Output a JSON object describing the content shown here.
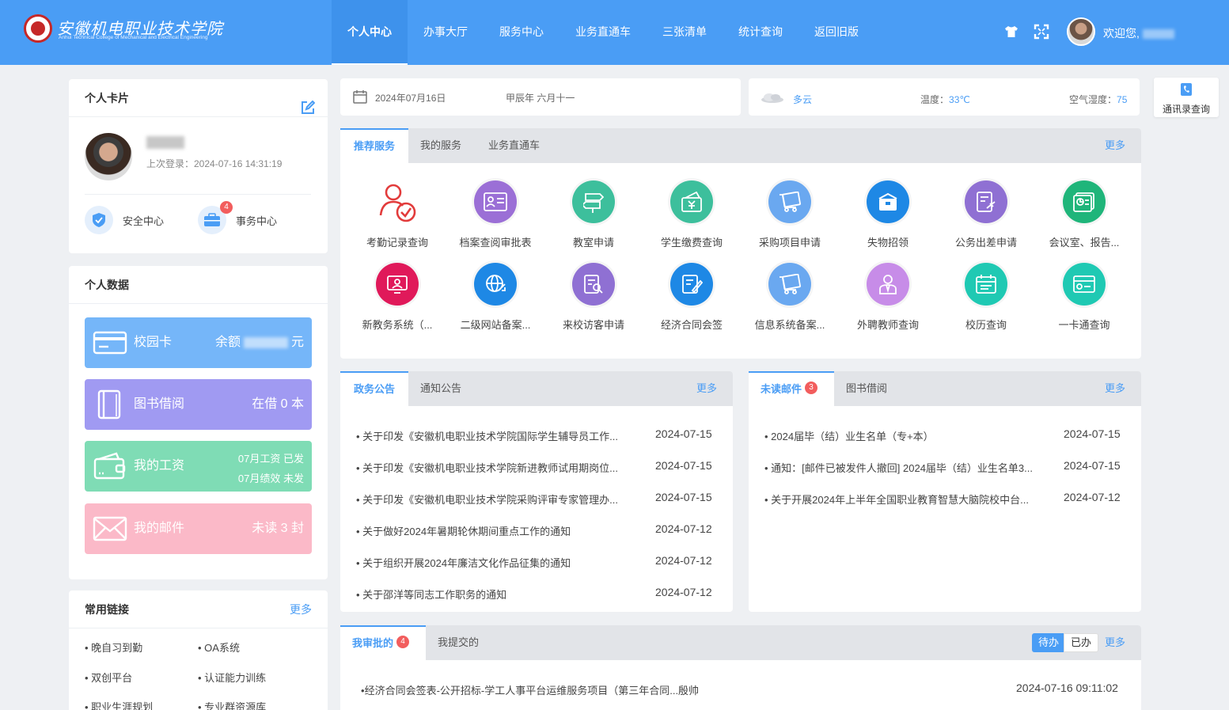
{
  "header": {
    "logo_cn": "安徽机电职业技术学院",
    "logo_en": "Anhui Technical College of Mechanical and Electrical Engineering",
    "nav": [
      "个人中心",
      "办事大厅",
      "服务中心",
      "业务直通车",
      "三张清单",
      "统计查询",
      "返回旧版"
    ],
    "welcome": "欢迎您,"
  },
  "personal_card": {
    "title": "个人卡片",
    "last_login": "上次登录：2024-07-16 14:31:19",
    "security": "安全中心",
    "affairs": "事务中心",
    "affairs_badge": "4"
  },
  "personal_data": {
    "title": "个人数据",
    "campus_card": {
      "name": "校园卡",
      "prefix": "余额",
      "suffix": "元"
    },
    "library": {
      "name": "图书借阅",
      "value": "在借 0 本"
    },
    "salary": {
      "name": "我的工资",
      "line1": "07月工资 已发",
      "line2": "07月绩效 未发"
    },
    "mail": {
      "name": "我的邮件",
      "value": "未读 3 封"
    }
  },
  "links": {
    "title": "常用链接",
    "more": "更多",
    "items": [
      "晚自习到勤",
      "OA系统",
      "双创平台",
      "认证能力训练",
      "职业生涯规划",
      "专业群资源库"
    ]
  },
  "datebar": {
    "date": "2024年07月16日",
    "lunar": "甲辰年 六月十一"
  },
  "weather": {
    "desc": "多云",
    "temp_label": "温度：",
    "temp": "33℃",
    "hum_label": "空气湿度：",
    "hum": "75"
  },
  "contact": "通讯录查询",
  "services": {
    "tabs": [
      "推荐服务",
      "我的服务",
      "业务直通车"
    ],
    "more": "更多",
    "items": [
      {
        "label": "考勤记录查询",
        "color": "#ffffff"
      },
      {
        "label": "档案查阅审批表",
        "color": "#9b6fd6"
      },
      {
        "label": "教室申请",
        "color": "#3dbf9c"
      },
      {
        "label": "学生缴费查询",
        "color": "#3dbf9c"
      },
      {
        "label": "采购项目申请",
        "color": "#6aa8f0"
      },
      {
        "label": "失物招领",
        "color": "#1e88e5"
      },
      {
        "label": "公务出差申请",
        "color": "#8f70d3"
      },
      {
        "label": "会议室、报告...",
        "color": "#1fb57a"
      },
      {
        "label": "新教务系统（...",
        "color": "#e0195a"
      },
      {
        "label": "二级网站备案...",
        "color": "#1e88e5"
      },
      {
        "label": "来校访客申请",
        "color": "#8f70d3"
      },
      {
        "label": "经济合同会签",
        "color": "#1e88e5"
      },
      {
        "label": "信息系统备案...",
        "color": "#6aa8f0"
      },
      {
        "label": "外聘教师查询",
        "color": "#c78ce8"
      },
      {
        "label": "校历查询",
        "color": "#1fc9b3"
      },
      {
        "label": "一卡通查询",
        "color": "#1fc9b3"
      }
    ]
  },
  "notices": {
    "tabs": [
      "政务公告",
      "通知公告"
    ],
    "more": "更多",
    "items": [
      {
        "title": "关于印发《安徽机电职业技术学院国际学生辅导员工作...",
        "date": "2024-07-15"
      },
      {
        "title": "关于印发《安徽机电职业技术学院新进教师试用期岗位...",
        "date": "2024-07-15"
      },
      {
        "title": "关于印发《安徽机电职业技术学院采购评审专家管理办...",
        "date": "2024-07-15"
      },
      {
        "title": "关于做好2024年暑期轮休期间重点工作的通知",
        "date": "2024-07-12"
      },
      {
        "title": "关于组织开展2024年廉洁文化作品征集的通知",
        "date": "2024-07-12"
      },
      {
        "title": "关于邵洋等同志工作职务的通知",
        "date": "2024-07-12"
      }
    ]
  },
  "mails": {
    "tabs": [
      "未读邮件",
      "图书借阅"
    ],
    "badge": "3",
    "more": "更多",
    "items": [
      {
        "title": "2024届毕（结）业生名单（专+本）",
        "date": "2024-07-15"
      },
      {
        "title": "通知：[邮件已被发件人撤回] 2024届毕（结）业生名单3...",
        "date": "2024-07-15"
      },
      {
        "title": "关于开展2024年上半年全国职业教育智慧大脑院校中台...",
        "date": "2024-07-12"
      }
    ]
  },
  "approvals": {
    "tabs": [
      "我审批的",
      "我提交的"
    ],
    "badge": "4",
    "seg_pending": "待办",
    "seg_done": "已办",
    "more": "更多",
    "items": [
      {
        "title": "经济合同会签表-公开招标-学工人事平台运维服务项目（第三年合同...殷帅",
        "date": "2024-07-16 09:11:02"
      }
    ]
  }
}
